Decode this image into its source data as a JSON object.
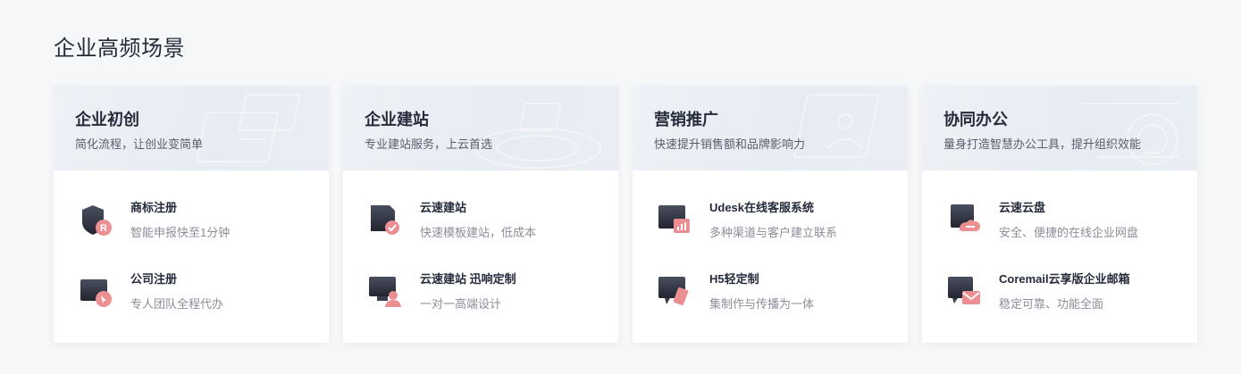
{
  "section": {
    "title": "企业高频场景"
  },
  "cards": [
    {
      "title": "企业初创",
      "subtitle": "简化流程，让创业变简单",
      "items": [
        {
          "title": "商标注册",
          "desc": "智能申报快至1分钟",
          "icon": "trademark-r-icon"
        },
        {
          "title": "公司注册",
          "desc": "专人团队全程代办",
          "icon": "company-register-icon"
        }
      ]
    },
    {
      "title": "企业建站",
      "subtitle": "专业建站服务，上云首选",
      "items": [
        {
          "title": "云速建站",
          "desc": "快速模板建站，低成本",
          "icon": "quick-site-icon"
        },
        {
          "title": "云速建站 迅响定制",
          "desc": "一对一高端设计",
          "icon": "custom-site-icon"
        }
      ]
    },
    {
      "title": "营销推广",
      "subtitle": "快速提升销售额和品牌影响力",
      "items": [
        {
          "title": "Udesk在线客服系统",
          "desc": "多种渠道与客户建立联系",
          "icon": "customer-service-icon"
        },
        {
          "title": "H5轻定制",
          "desc": "集制作与传播为一体",
          "icon": "h5-icon"
        }
      ]
    },
    {
      "title": "协同办公",
      "subtitle": "量身打造智慧办公工具，提升组织效能",
      "items": [
        {
          "title": "云速云盘",
          "desc": "安全、便捷的在线企业网盘",
          "icon": "cloud-disk-icon"
        },
        {
          "title": "Coremail云享版企业邮箱",
          "desc": "稳定可靠、功能全面",
          "icon": "mail-icon"
        }
      ]
    }
  ],
  "colors": {
    "icon_dark": "#2b2f3d",
    "icon_accent": "#e8737a",
    "header_bg": "#e9edf3"
  }
}
